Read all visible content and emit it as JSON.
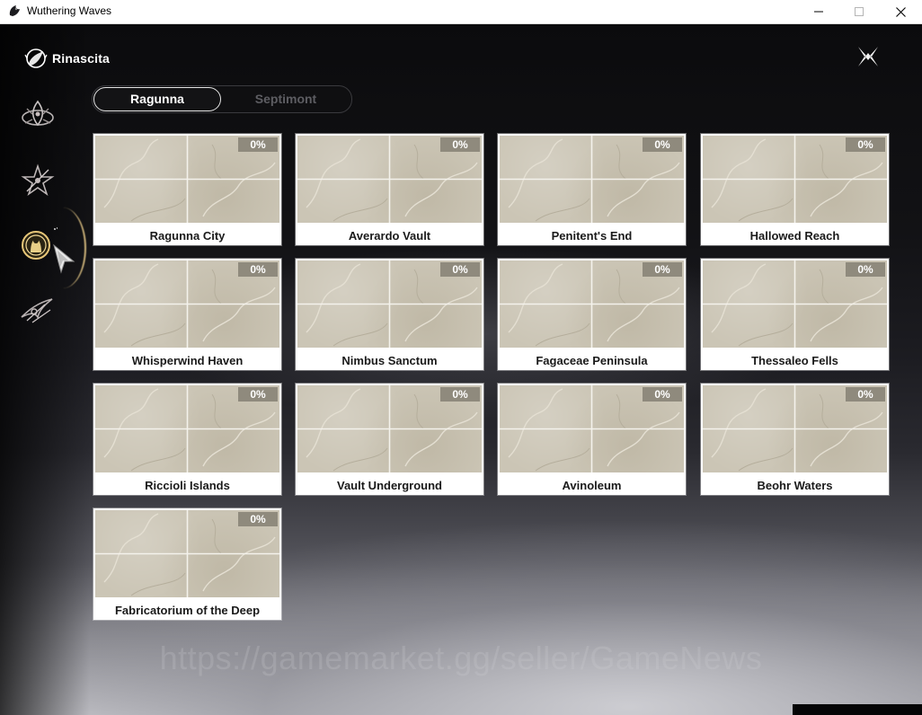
{
  "window": {
    "title": "Wuthering Waves",
    "icon": "game-icon",
    "controls": [
      "minimize-icon",
      "maximize-icon",
      "close-icon"
    ]
  },
  "header": {
    "brand_label": "Rinascita",
    "brand_icon": "rinascita-emblem-icon",
    "close_icon": "close-x-icon"
  },
  "sidebar": {
    "items": [
      {
        "icon": "dragon-emblem-icon",
        "active": false
      },
      {
        "icon": "star-crest-icon",
        "active": false
      },
      {
        "icon": "portrait-medal-icon",
        "active": true
      },
      {
        "icon": "winged-crest-icon",
        "active": false
      }
    ]
  },
  "tabs": [
    {
      "label": "Ragunna",
      "active": true
    },
    {
      "label": "Septimont",
      "active": false
    }
  ],
  "regions": [
    {
      "name": "Ragunna City",
      "progress": "0%"
    },
    {
      "name": "Averardo Vault",
      "progress": "0%"
    },
    {
      "name": "Penitent's End",
      "progress": "0%"
    },
    {
      "name": "Hallowed Reach",
      "progress": "0%"
    },
    {
      "name": "Whisperwind Haven",
      "progress": "0%"
    },
    {
      "name": "Nimbus Sanctum",
      "progress": "0%"
    },
    {
      "name": "Fagaceae Peninsula",
      "progress": "0%"
    },
    {
      "name": "Thessaleo Fells",
      "progress": "0%"
    },
    {
      "name": "Riccioli Islands",
      "progress": "0%"
    },
    {
      "name": "Vault Underground",
      "progress": "0%"
    },
    {
      "name": "Avinoleum",
      "progress": "0%"
    },
    {
      "name": "Beohr Waters",
      "progress": "0%"
    },
    {
      "name": "Fabricatorium of the Deep",
      "progress": "0%"
    }
  ],
  "watermark": "https://gamemarket.gg/seller/GameNews",
  "colors": {
    "accent_gold": "#eed08c",
    "card_map": "#cbc5b5",
    "badge": "#8f8a7d",
    "inactive_tab": "#5d5d62"
  }
}
